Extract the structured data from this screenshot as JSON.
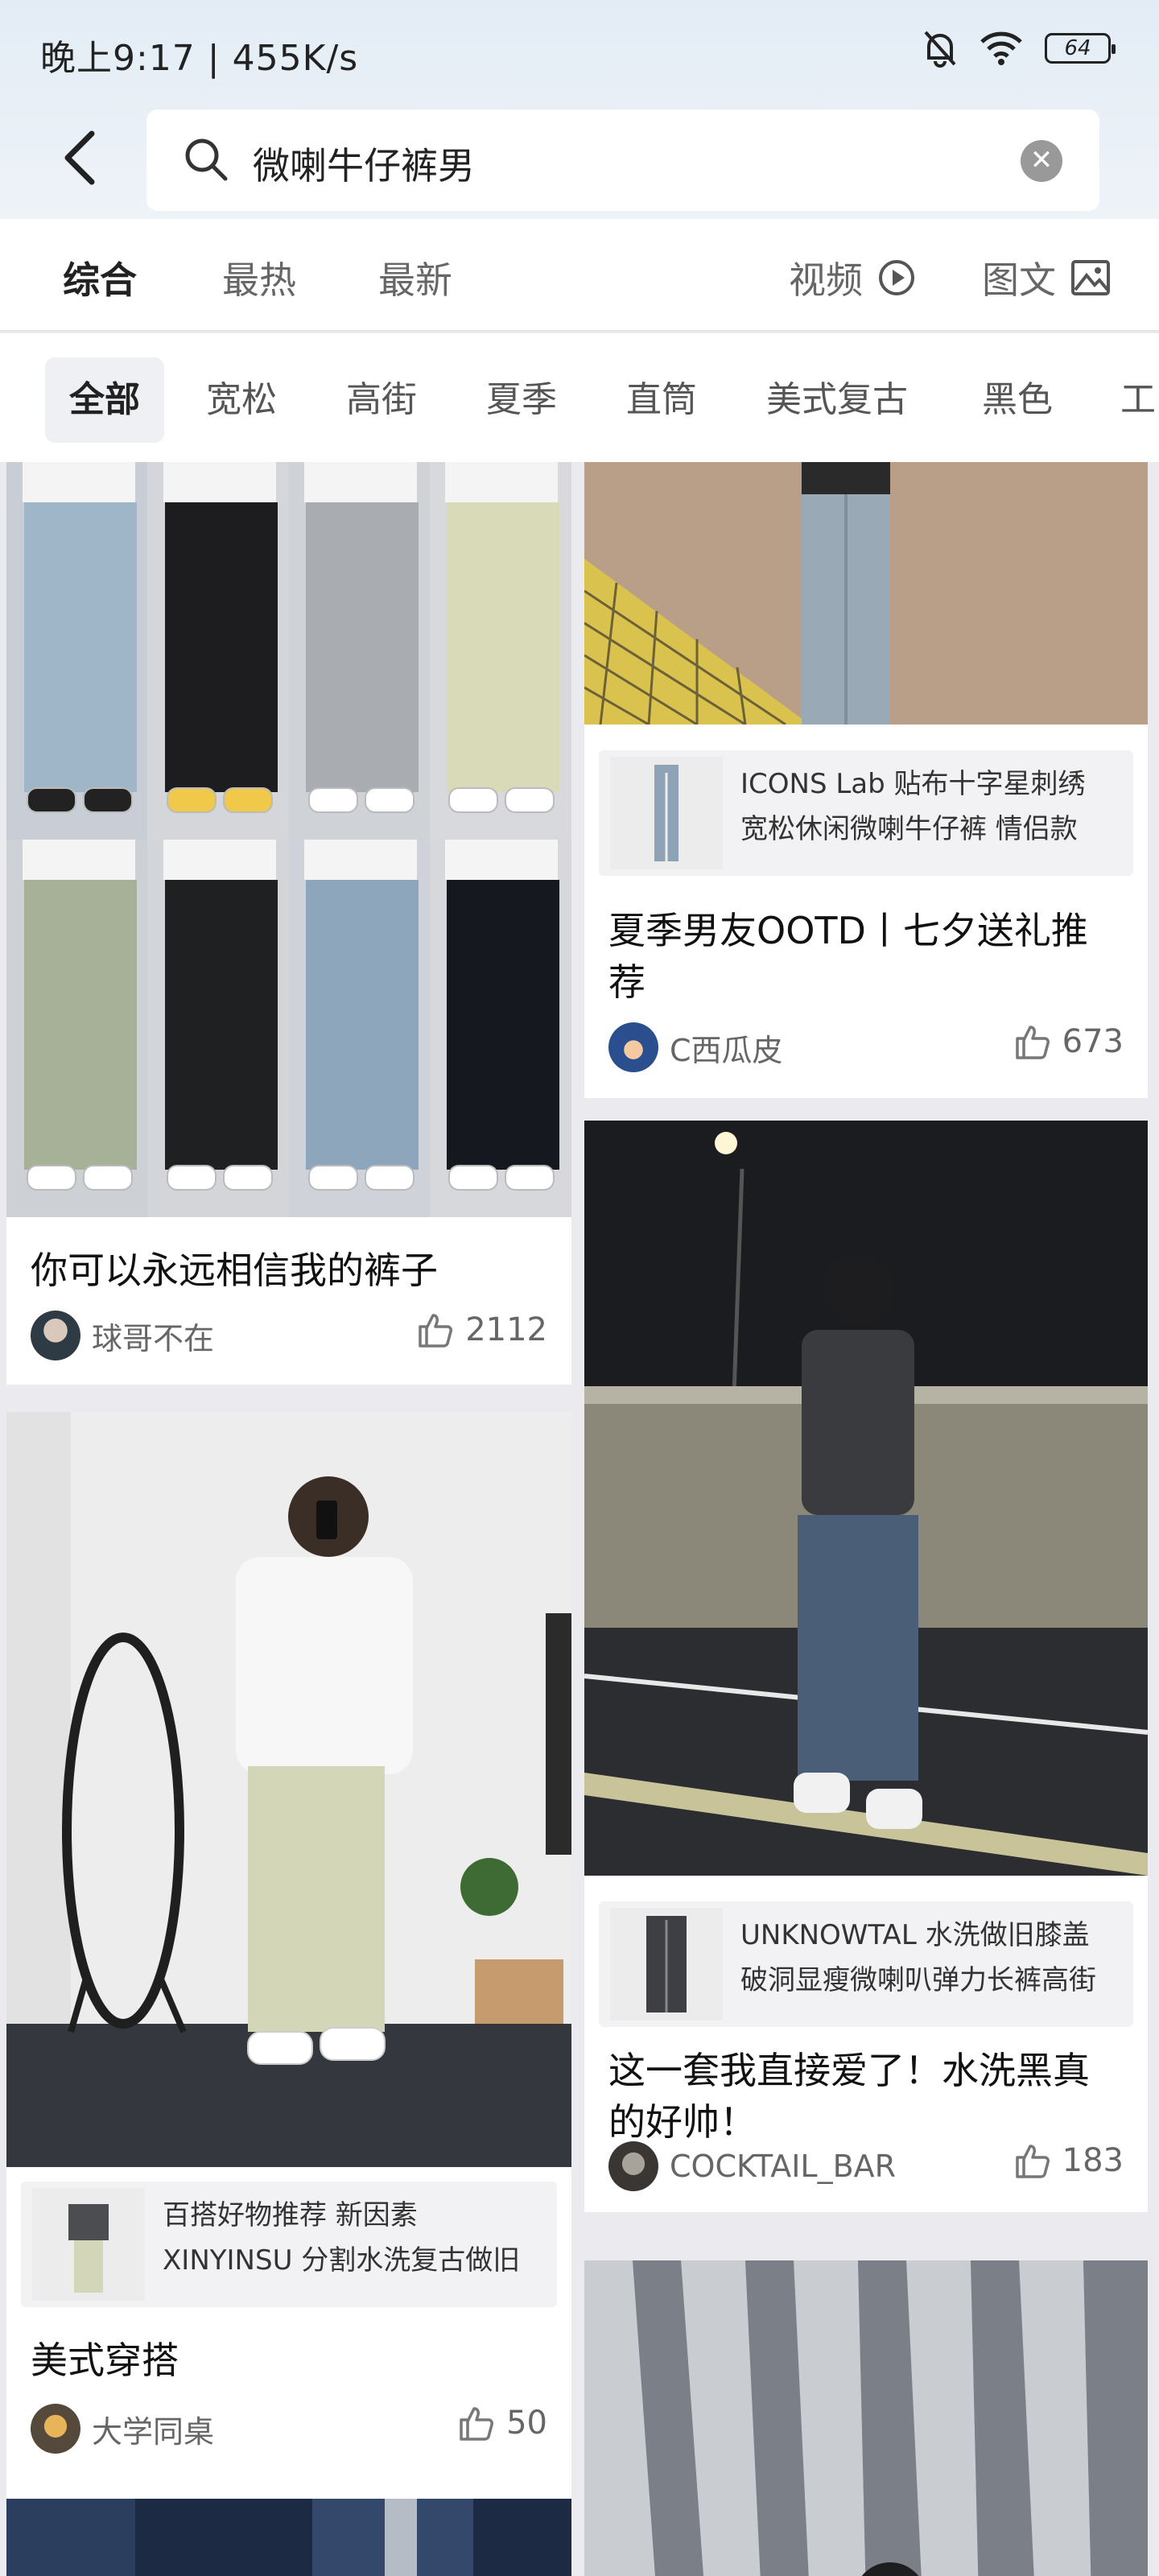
{
  "status_bar": {
    "time": "晚上9:17 | 455K/s",
    "battery": "64"
  },
  "search": {
    "query": "微喇牛仔裤男"
  },
  "sort_tabs": [
    "综合",
    "最热",
    "最新"
  ],
  "media_tabs": {
    "video": "视频",
    "image_text": "图文"
  },
  "filters": [
    "全部",
    "宽松",
    "高街",
    "夏季",
    "直筒",
    "美式复古",
    "黑色",
    "工"
  ],
  "cards": {
    "c1": {
      "title": "你可以永远相信我的裤子",
      "author": "球哥不在",
      "likes": "2112"
    },
    "c2": {
      "product_line1": "ICONS Lab  贴布十字星刺绣",
      "product_line2": "宽松休闲微喇牛仔裤  情侣款",
      "title_line1": "夏季男友OOTD丨七夕送礼推",
      "title_line2": "荐",
      "author": "C西瓜皮",
      "likes": "673"
    },
    "c3": {
      "product_line1": "百搭好物推荐 新因素",
      "product_line2": "XINYINSU 分割水洗复古做旧",
      "title": "美式穿搭",
      "author": "大学同桌",
      "likes": "50"
    },
    "c4": {
      "product_line1": "UNKNOWTAL 水洗做旧膝盖",
      "product_line2": "破洞显瘦微喇叭弹力长裤高街",
      "title_line1": "这一套我直接爱了！水洗黑真",
      "title_line2": "的好帅！",
      "author": "COCKTAIL_BAR",
      "likes": "183"
    }
  },
  "colors": {
    "accent_text": "#222222",
    "muted_text": "#666666",
    "feed_bg": "#ebebef",
    "header_bg": "#e3ecf5"
  }
}
